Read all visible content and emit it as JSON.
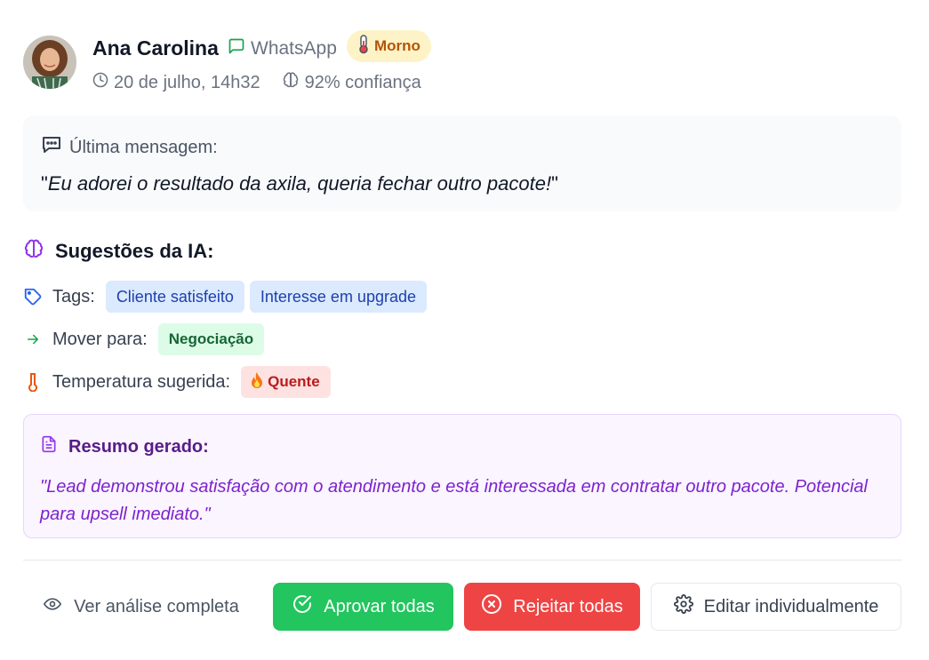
{
  "contact": {
    "name": "Ana Carolina",
    "channel": "WhatsApp",
    "temperature": "Morno",
    "datetime": "20 de julho, 14h32",
    "confidence": "92% confiança"
  },
  "last_message": {
    "label": "Última mensagem:",
    "text": "Eu adorei o resultado da axila, queria fechar outro pacote!"
  },
  "ai": {
    "title": "Sugestões da IA:",
    "tags_label": "Tags:",
    "tags": [
      "Cliente satisfeito",
      "Interesse em upgrade"
    ],
    "move_label": "Mover para:",
    "move_to": "Negociação",
    "temp_label": "Temperatura sugerida:",
    "temp_value": "Quente"
  },
  "summary": {
    "label": "Resumo gerado:",
    "text": "\"Lead demonstrou satisfação com o atendimento e está interessada em contratar outro pacote. Potencial para upsell imediato.\""
  },
  "actions": {
    "view": "Ver análise completa",
    "approve": "Aprovar todas",
    "reject": "Rejeitar todas",
    "edit": "Editar individualmente"
  },
  "colors": {
    "approve": "#22c55e",
    "reject": "#ef4444",
    "ai_accent": "#9333ea",
    "whatsapp": "#16a34a"
  },
  "icons": [
    "avatar-photo",
    "chat-icon",
    "thermometer-icon",
    "clock-icon",
    "brain-icon",
    "message-dots-icon",
    "tag-icon",
    "arrow-right-icon",
    "fire-icon",
    "document-icon",
    "eye-icon",
    "check-circle-icon",
    "x-circle-icon",
    "gear-icon"
  ]
}
